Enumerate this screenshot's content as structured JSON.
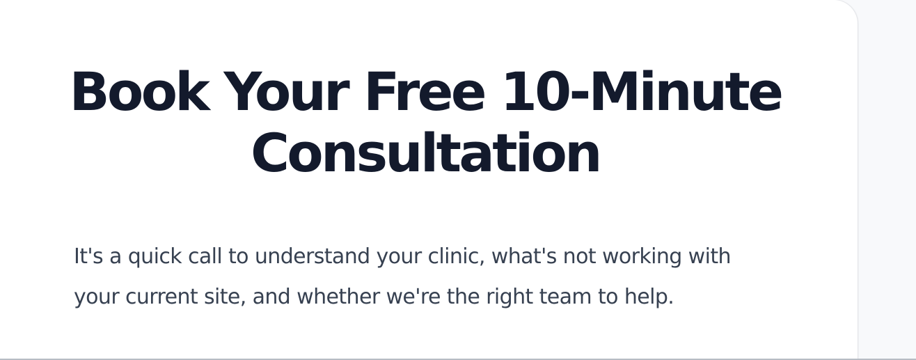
{
  "consultation": {
    "title": "Book Your Free 10-Minute Consultation",
    "description": "It's a quick call to understand your clinic, what's not working with your current site, and whether we're the right team to help."
  },
  "colors": {
    "heading": "#131a2c",
    "body": "#374151",
    "card_background": "#ffffff",
    "page_background": "#f8f9fb"
  }
}
